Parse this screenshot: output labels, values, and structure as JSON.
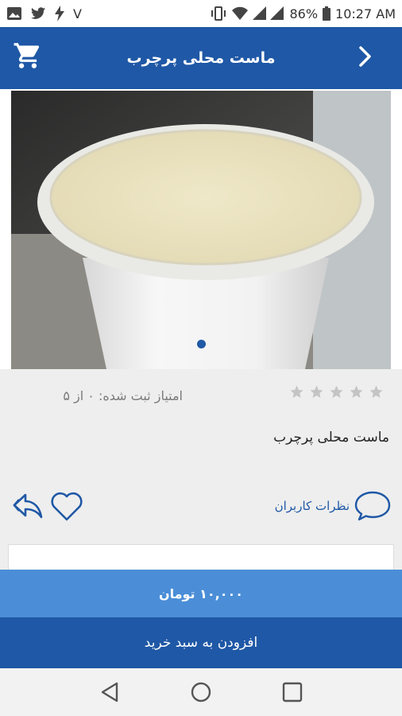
{
  "status_bar": {
    "carrier_letter": "V",
    "battery_percent": "86%",
    "time": "10:27 AM",
    "icons": [
      "image-icon",
      "twitter-icon",
      "flash-icon",
      "vibrate-icon",
      "wifi-icon",
      "signal-icon",
      "battery-icon"
    ]
  },
  "app_bar": {
    "title": "ماست محلی پرچرب",
    "icons": [
      "cart-icon",
      "chevron-right-icon"
    ]
  },
  "product": {
    "rating_text": "امتیاز ثبت شده: ۰ از ۵",
    "rating_value": 0,
    "rating_max": 5,
    "name": "ماست محلی پرچرب",
    "image_pages": 1,
    "current_image_page": 1
  },
  "actions": {
    "comments_label": "نظرات کاربران",
    "icons": [
      "share-icon",
      "heart-icon",
      "comment-icon"
    ]
  },
  "purchase": {
    "price_label": "۱۰,۰۰۰ تومان",
    "add_to_cart_label": "افزودن به سبد خرید"
  },
  "colors": {
    "primary": "#1f58a6",
    "secondary": "#4b8ed7",
    "info_bg": "#eeeeee"
  },
  "nav_bar": {
    "icons": [
      "back-triangle-icon",
      "home-circle-icon",
      "recents-square-icon"
    ]
  }
}
